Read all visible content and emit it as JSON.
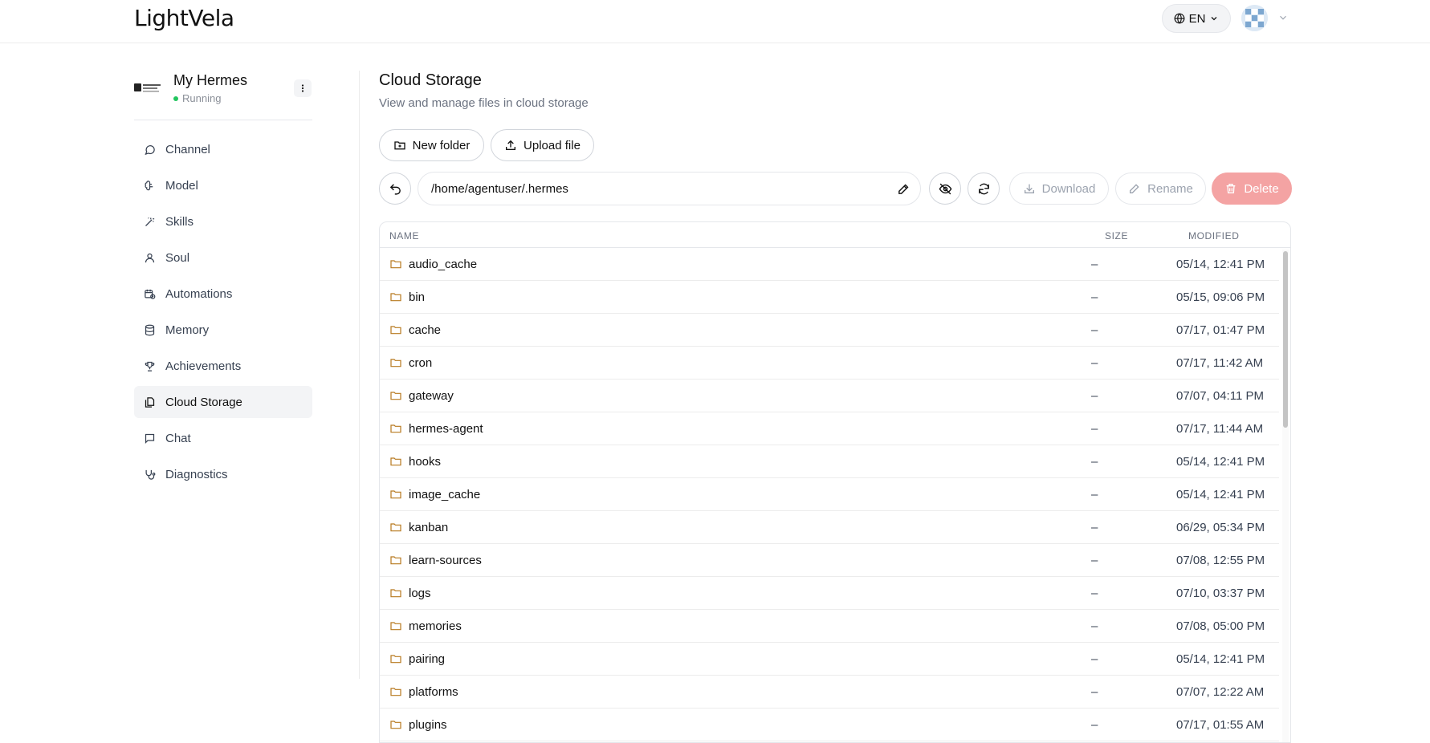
{
  "header": {
    "logo": "LightVela",
    "language": "EN"
  },
  "sidebar": {
    "agent": {
      "name": "My Hermes",
      "status": "Running"
    },
    "items": [
      {
        "label": "Channel",
        "icon": "chat-bubble-icon",
        "active": false
      },
      {
        "label": "Model",
        "icon": "brain-icon",
        "active": false
      },
      {
        "label": "Skills",
        "icon": "magic-wand-icon",
        "active": false
      },
      {
        "label": "Soul",
        "icon": "user-icon",
        "active": false
      },
      {
        "label": "Automations",
        "icon": "calendar-clock-icon",
        "active": false
      },
      {
        "label": "Memory",
        "icon": "database-icon",
        "active": false
      },
      {
        "label": "Achievements",
        "icon": "trophy-icon",
        "active": false
      },
      {
        "label": "Cloud Storage",
        "icon": "files-icon",
        "active": true
      },
      {
        "label": "Chat",
        "icon": "message-square-icon",
        "active": false
      },
      {
        "label": "Diagnostics",
        "icon": "stethoscope-icon",
        "active": false
      }
    ]
  },
  "main": {
    "title": "Cloud Storage",
    "subtitle": "View and manage files in cloud storage",
    "new_folder_label": "New folder",
    "upload_label": "Upload file",
    "path": "/home/agentuser/.hermes",
    "download_label": "Download",
    "rename_label": "Rename",
    "delete_label": "Delete",
    "table": {
      "headers": {
        "name": "NAME",
        "size": "SIZE",
        "modified": "MODIFIED"
      },
      "rows": [
        {
          "name": "audio_cache",
          "size": "–",
          "modified": "05/14, 12:41 PM"
        },
        {
          "name": "bin",
          "size": "–",
          "modified": "05/15, 09:06 PM"
        },
        {
          "name": "cache",
          "size": "–",
          "modified": "07/17, 01:47 PM"
        },
        {
          "name": "cron",
          "size": "–",
          "modified": "07/17, 11:42 AM"
        },
        {
          "name": "gateway",
          "size": "–",
          "modified": "07/07, 04:11 PM"
        },
        {
          "name": "hermes-agent",
          "size": "–",
          "modified": "07/17, 11:44 AM"
        },
        {
          "name": "hooks",
          "size": "–",
          "modified": "05/14, 12:41 PM"
        },
        {
          "name": "image_cache",
          "size": "–",
          "modified": "05/14, 12:41 PM"
        },
        {
          "name": "kanban",
          "size": "–",
          "modified": "06/29, 05:34 PM"
        },
        {
          "name": "learn-sources",
          "size": "–",
          "modified": "07/08, 12:55 PM"
        },
        {
          "name": "logs",
          "size": "–",
          "modified": "07/10, 03:37 PM"
        },
        {
          "name": "memories",
          "size": "–",
          "modified": "07/08, 05:00 PM"
        },
        {
          "name": "pairing",
          "size": "–",
          "modified": "05/14, 12:41 PM"
        },
        {
          "name": "platforms",
          "size": "–",
          "modified": "07/07, 12:22 AM"
        },
        {
          "name": "plugins",
          "size": "–",
          "modified": "07/17, 01:55 AM"
        }
      ]
    }
  },
  "colors": {
    "folder": "#b7791f",
    "active_bg": "#f3f4f6",
    "delete_bg": "#f4a3a3",
    "status_running": "#22c55e"
  }
}
